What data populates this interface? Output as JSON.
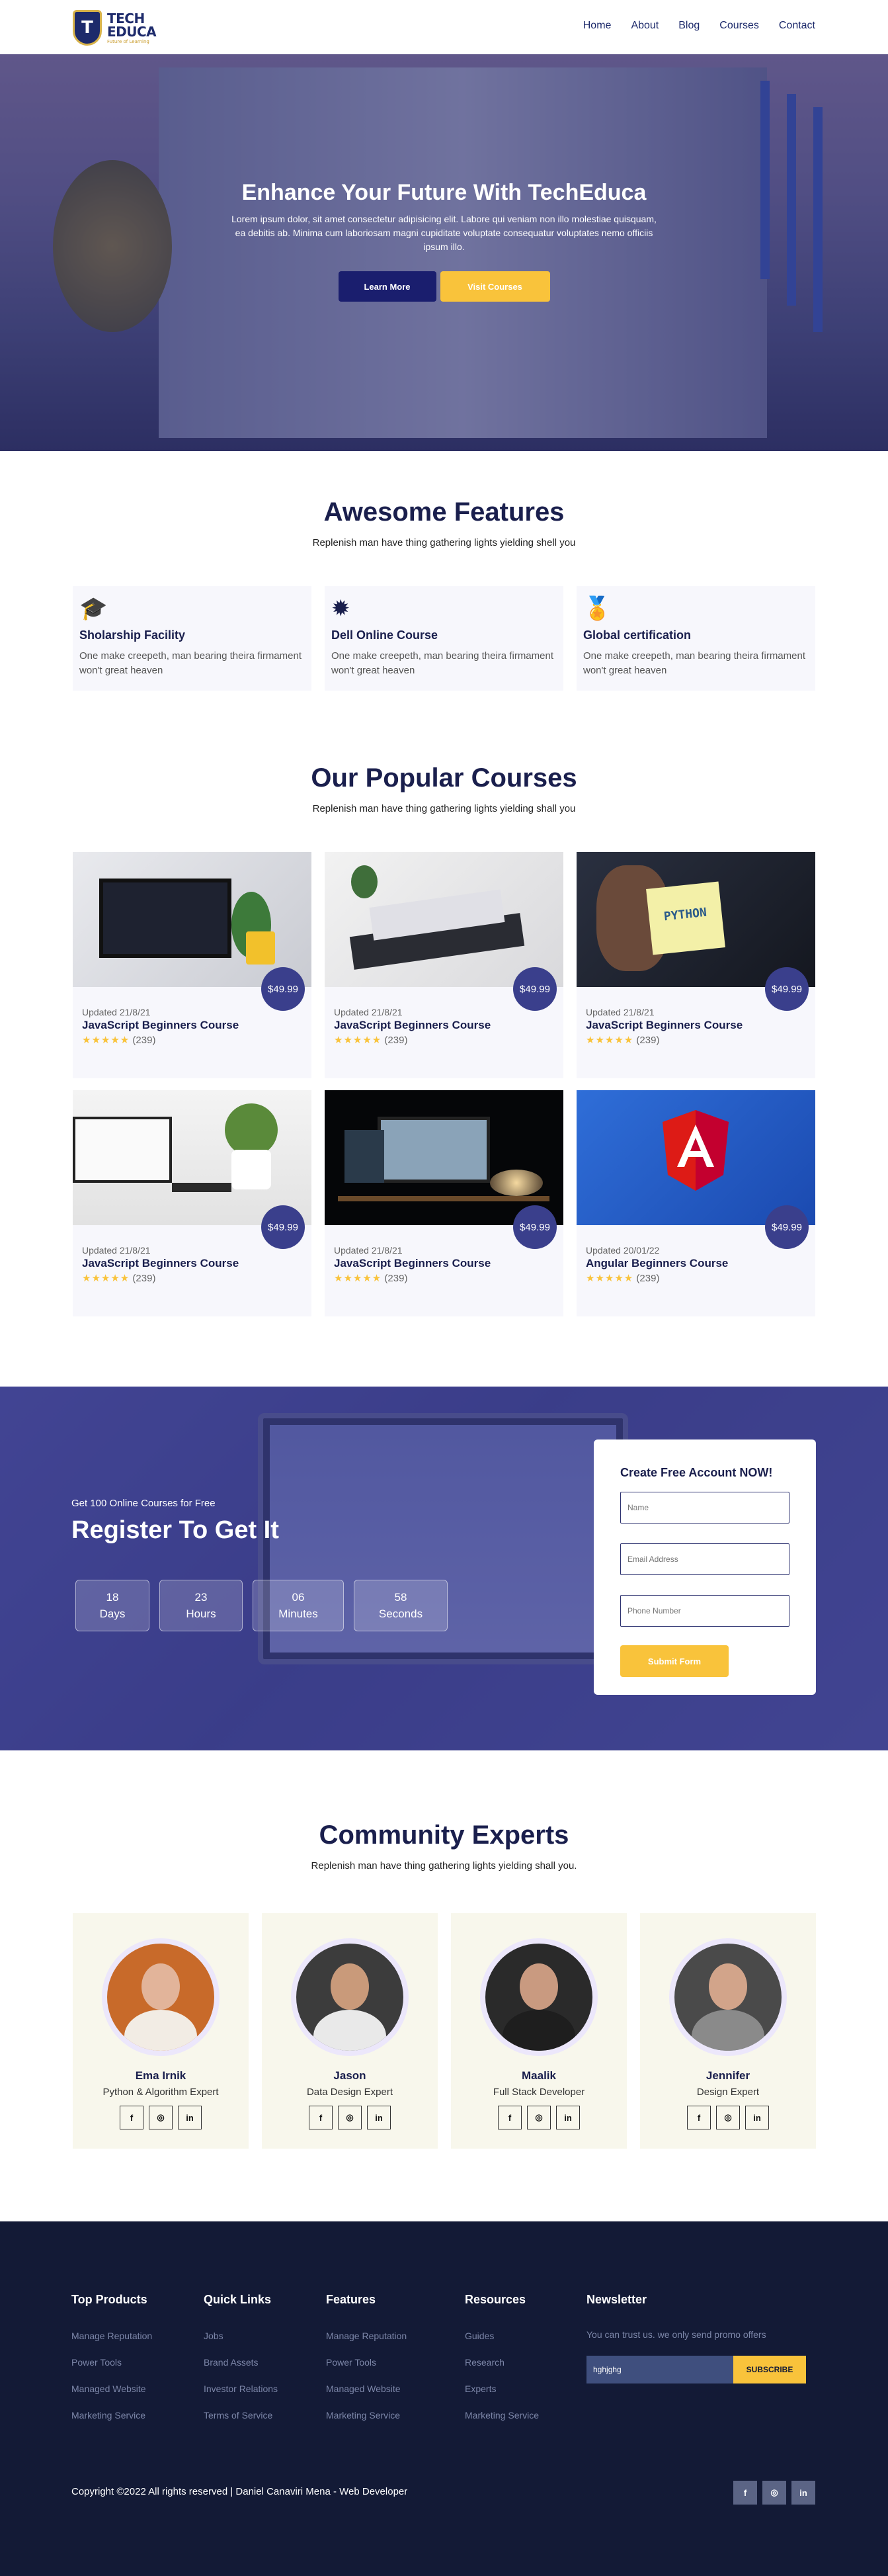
{
  "brand": {
    "title_line1": "TECH",
    "title_line2": "EDUCA",
    "tagline": "Future of Learning",
    "logo_letter": "T"
  },
  "nav": {
    "items": [
      "Home",
      "About",
      "Blog",
      "Courses",
      "Contact"
    ]
  },
  "hero": {
    "title": "Enhance Your Future With TechEduca",
    "text": "Lorem ipsum dolor, sit amet consectetur adipisicing elit. Labore qui veniam non illo molestiae quisquam, ea debitis ab. Minima cum laboriosam magni cupiditate voluptate consequatur voluptates nemo officiis ipsum illo.",
    "primary_button": "Learn More",
    "secondary_button": "Visit Courses"
  },
  "features": {
    "title": "Awesome Features",
    "subtitle": "Replenish man have thing gathering lights yielding shell you",
    "items": [
      {
        "icon": "graduation-cap-icon",
        "title": "Sholarship Facility",
        "text": "One make creepeth, man bearing theira firmament won't great heaven"
      },
      {
        "icon": "badge-icon",
        "title": "Dell Online Course",
        "text": "One make creepeth, man bearing theira firmament won't great heaven"
      },
      {
        "icon": "award-icon",
        "title": "Global certification",
        "text": "One make creepeth, man bearing theira firmament won't great heaven"
      }
    ]
  },
  "courses": {
    "title": "Our Popular Courses",
    "subtitle": "Replenish man have thing gathering lights yielding shall you",
    "items": [
      {
        "image": "laptop-code",
        "price": "$49.99",
        "updated": "Updated 21/8/21",
        "title": "JavaScript Beginners Course",
        "reviews": "(239)",
        "stars": "★★★★★"
      },
      {
        "image": "books-desk",
        "price": "$49.99",
        "updated": "Updated 21/8/21",
        "title": "JavaScript Beginners Course",
        "reviews": "(239)",
        "stars": "★★★★★"
      },
      {
        "image": "python-note",
        "price": "$49.99",
        "updated": "Updated 21/8/21",
        "title": "JavaScript Beginners Course",
        "reviews": "(239)",
        "stars": "★★★★★"
      },
      {
        "image": "white-desk",
        "price": "$49.99",
        "updated": "Updated 21/8/21",
        "title": "JavaScript Beginners Course",
        "reviews": "(239)",
        "stars": "★★★★★"
      },
      {
        "image": "dark-desk",
        "price": "$49.99",
        "updated": "Updated 21/8/21",
        "title": "JavaScript Beginners Course",
        "reviews": "(239)",
        "stars": "★★★★★"
      },
      {
        "image": "angular-logo",
        "price": "$49.99",
        "updated": "Updated 20/01/22",
        "title": "Angular Beginners Course",
        "reviews": "(239)",
        "stars": "★★★★★"
      }
    ]
  },
  "register": {
    "kicker": "Get 100 Online Courses for Free",
    "title": "Register To Get It",
    "counters": [
      {
        "value": "18",
        "label": "Days"
      },
      {
        "value": "23",
        "label": "Hours"
      },
      {
        "value": "06",
        "label": "Minutes"
      },
      {
        "value": "58",
        "label": "Seconds"
      }
    ],
    "form": {
      "title": "Create Free Account NOW!",
      "name_placeholder": "Name",
      "email_placeholder": "Email Address",
      "phone_placeholder": "Phone Number",
      "submit": "Submit Form"
    }
  },
  "experts": {
    "title": "Community Experts",
    "subtitle": "Replenish man have thing gathering lights yielding shall you.",
    "items": [
      {
        "name": "Ema Irnik",
        "role": "Python & Algorithm Expert",
        "bg": "#c86a2a",
        "shirt": "#f2ece4"
      },
      {
        "name": "Jason",
        "role": "Data Design Expert",
        "bg": "#3c3c3c",
        "shirt": "#e9e9e9"
      },
      {
        "name": "Maalik",
        "role": "Full Stack Developer",
        "bg": "#2a2a2a",
        "shirt": "#1e1e1e"
      },
      {
        "name": "Jennifer",
        "role": "Design Expert",
        "bg": "#4a4a4a",
        "shirt": "#8a8a8a"
      }
    ],
    "social": [
      "f",
      "◎",
      "in"
    ]
  },
  "footer": {
    "columns": [
      {
        "title": "Top Products",
        "links": [
          "Manage Reputation",
          "Power Tools",
          "Managed Website",
          "Marketing Service"
        ]
      },
      {
        "title": "Quick Links",
        "links": [
          "Jobs",
          "Brand Assets",
          "Investor Relations",
          "Terms of Service"
        ]
      },
      {
        "title": "Features",
        "links": [
          "Manage Reputation",
          "Power Tools",
          "Managed Website",
          "Marketing Service"
        ]
      },
      {
        "title": "Resources",
        "links": [
          "Guides",
          "Research",
          "Experts",
          "Marketing Service"
        ]
      }
    ],
    "newsletter": {
      "title": "Newsletter",
      "text": "You can trust us. we only send promo offers",
      "input_value": "hghjghg",
      "button": "SUBSCRIBE"
    },
    "copyright": "Copyright ©2022 All rights reserved | Daniel Canaviri Mena - Web Developer",
    "social": [
      "f",
      "◎",
      "in"
    ]
  }
}
